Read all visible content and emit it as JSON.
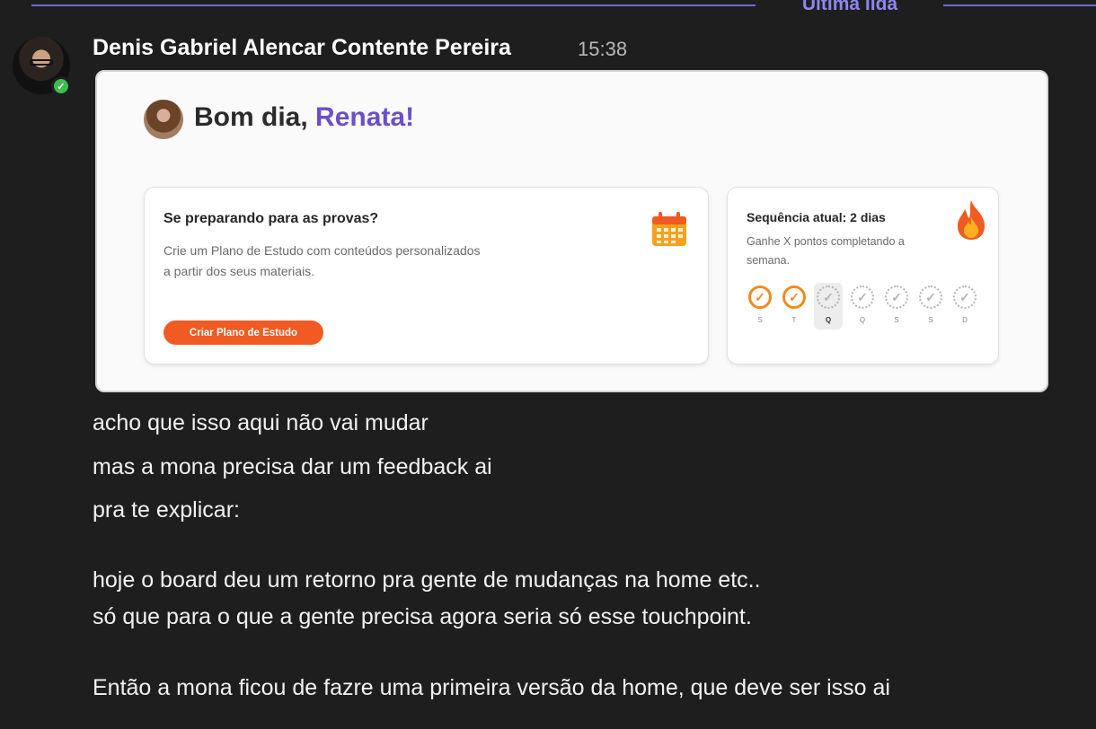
{
  "divider": {
    "label": "Última lida"
  },
  "message": {
    "sender": "Denis Gabriel Alencar Contente Pereira",
    "time": "15:38",
    "lines": [
      "acho que isso aqui não vai mudar",
      "mas a mona precisa dar um feedback ai",
      "pra te explicar:",
      "hoje o board deu um retorno pra gente de mudanças na home etc..",
      "só que para o que a gente precisa agora seria só esse touchpoint.",
      "Então a mona ficou de fazre uma primeira versão da home, que deve ser isso ai"
    ]
  },
  "preview": {
    "greeting": "Bom dia,",
    "user_name": "Renata!",
    "study_card": {
      "title": "Se preparando para as provas?",
      "desc_line1": "Crie um Plano de Estudo com conteúdos personalizados",
      "desc_line2": "a partir dos seus materiais.",
      "button": "Criar Plano de Estudo"
    },
    "streak_card": {
      "title": "Sequência atual: 2 dias",
      "desc_line1": "Ganhe X pontos completando a",
      "desc_line2": "semana.",
      "days": [
        "S",
        "T",
        "Q",
        "Q",
        "S",
        "S",
        "D"
      ],
      "completed": [
        true,
        true,
        false,
        false,
        false,
        false,
        false
      ],
      "current_day_index": 2
    }
  },
  "colors": {
    "accent_divider": "#8d86f0",
    "brand_purple": "#6b4fc9",
    "cta_orange": "#f15a22",
    "streak_orange": "#f28b1e",
    "online_green": "#3ebd4f"
  }
}
